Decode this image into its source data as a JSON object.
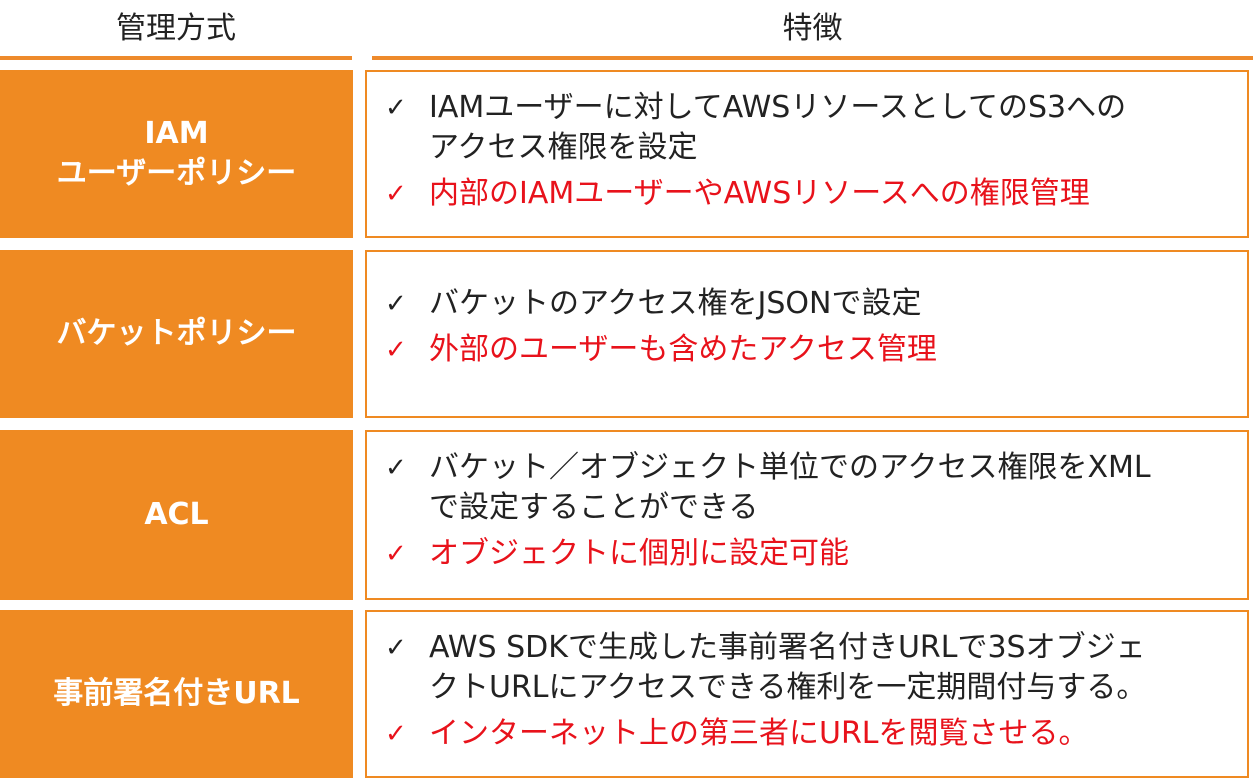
{
  "header": {
    "left": "管理方式",
    "right": "特徴"
  },
  "rows": [
    {
      "label_line1": "IAM",
      "label_line2": "ユーザーポリシー",
      "items": [
        {
          "text": "IAMユーザーに対してAWSリソースとしてのS3への\nアクセス権限を設定",
          "color": "#222222"
        },
        {
          "text": "内部のIAMユーザーやAWSリソースへの権限管理",
          "color": "#e8121b"
        }
      ]
    },
    {
      "label_line1": "バケットポリシー",
      "items": [
        {
          "text": "バケットのアクセス権をJSONで設定",
          "color": "#222222"
        },
        {
          "text": "外部のユーザーも含めたアクセス管理",
          "color": "#e8121b"
        }
      ]
    },
    {
      "label_line1": "ACL",
      "items": [
        {
          "text": "バケット／オブジェクト単位でのアクセス権限をXML\nで設定することができる",
          "color": "#222222"
        },
        {
          "text": "オブジェクトに個別に設定可能",
          "color": "#e8121b"
        }
      ]
    },
    {
      "label_line1": "事前署名付きURL",
      "items": [
        {
          "text": "AWS SDKで生成した事前署名付きURLで3Sオブジェ\nクトURLにアクセスできる権利を一定期間付与する。",
          "color": "#222222"
        },
        {
          "text": "インターネット上の第三者にURLを閲覧させる。",
          "color": "#e8121b"
        }
      ]
    }
  ],
  "check_mark": "✓",
  "colors": {
    "accent": "#ef8a22",
    "highlight": "#e8121b",
    "text": "#222222"
  }
}
